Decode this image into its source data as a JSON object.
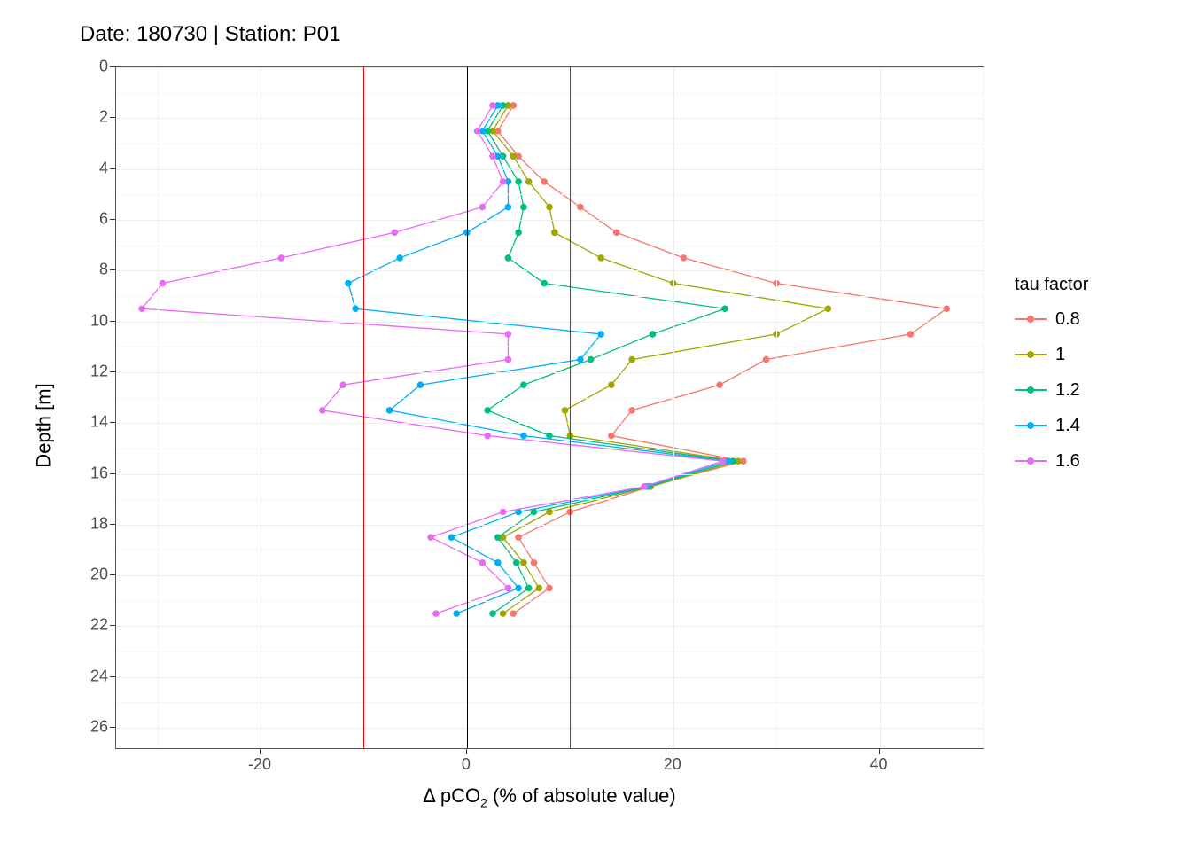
{
  "chart_data": {
    "type": "line",
    "title": "Date: 180730 | Station: P01",
    "xlabel": "Δ pCO₂ (% of absolute value)",
    "ylabel": "Depth [m]",
    "xlim": [
      -34,
      50
    ],
    "ylim_reversed": [
      26.8,
      0
    ],
    "x_ticks": [
      -20,
      0,
      20,
      40
    ],
    "y_ticks": [
      0,
      2,
      4,
      6,
      8,
      10,
      12,
      14,
      16,
      18,
      20,
      22,
      24,
      26
    ],
    "reference_lines_x": [
      {
        "x": 0,
        "color": "black"
      },
      {
        "x": -10,
        "color": "red"
      },
      {
        "x": 10,
        "color": "red"
      }
    ],
    "legend_title": "tau factor",
    "depths": [
      1.5,
      2.5,
      3.5,
      4.5,
      5.5,
      6.5,
      7.5,
      8.5,
      9.5,
      10.5,
      11.5,
      12.5,
      13.5,
      14.5,
      15.5,
      16.5,
      17.5,
      18.5,
      19.5,
      20.5,
      21.5
    ],
    "series": [
      {
        "name": "0.8",
        "color": "#F8766D",
        "x": [
          4.5,
          3.0,
          5.0,
          7.5,
          11.0,
          14.5,
          21.0,
          30.0,
          46.5,
          43.0,
          29.0,
          24.5,
          16.0,
          14.0,
          26.8,
          17.8,
          10.0,
          5.0,
          6.5,
          8.0,
          4.5
        ]
      },
      {
        "name": "1",
        "color": "#A3A500",
        "x": [
          4.0,
          2.5,
          4.5,
          6.0,
          8.0,
          8.5,
          13.0,
          20.0,
          35.0,
          30.0,
          16.0,
          14.0,
          9.5,
          10.0,
          26.3,
          17.8,
          8.0,
          3.5,
          5.5,
          7.0,
          3.5
        ]
      },
      {
        "name": "1.2",
        "color": "#00BF7D",
        "x": [
          3.5,
          2.0,
          3.5,
          5.0,
          5.5,
          5.0,
          4.0,
          7.5,
          25.0,
          18.0,
          12.0,
          5.5,
          2.0,
          8.0,
          25.8,
          17.6,
          6.5,
          3.0,
          4.8,
          6.0,
          2.5
        ]
      },
      {
        "name": "1.4",
        "color": "#00B0F6",
        "x": [
          3.0,
          1.5,
          3.0,
          4.0,
          4.0,
          0.0,
          -6.5,
          -11.5,
          -10.8,
          13.0,
          11.0,
          -4.5,
          -7.5,
          5.5,
          25.3,
          17.4,
          5.0,
          -1.5,
          3.0,
          5.0,
          -1.0
        ]
      },
      {
        "name": "1.6",
        "color": "#E76BF3",
        "x": [
          2.5,
          1.0,
          2.5,
          3.5,
          1.5,
          -7.0,
          -18.0,
          -29.5,
          -31.5,
          4.0,
          4.0,
          -12.0,
          -14.0,
          2.0,
          24.8,
          17.2,
          3.5,
          -3.5,
          1.5,
          4.0,
          -3.0
        ]
      }
    ]
  }
}
